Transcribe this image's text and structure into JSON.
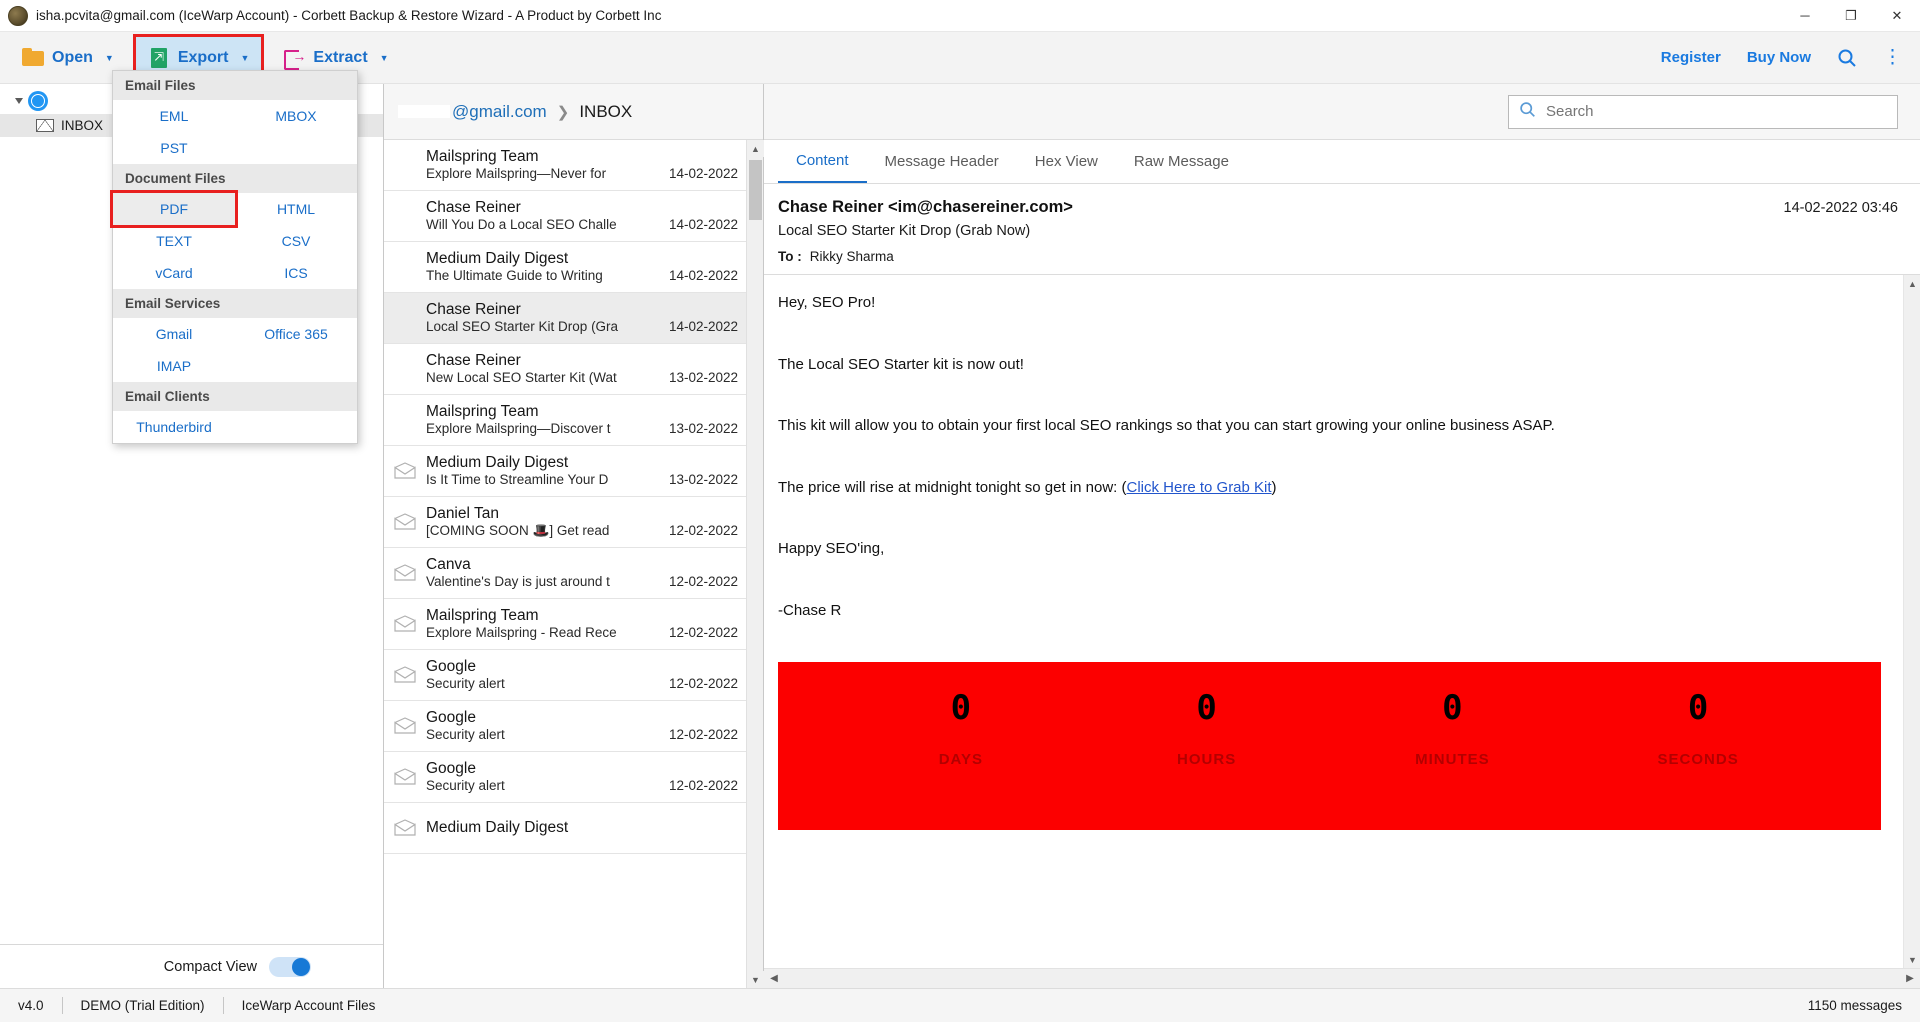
{
  "titlebar": {
    "title": "isha.pcvita@gmail.com (IceWarp Account) - Corbett Backup & Restore Wizard - A Product by Corbett Inc",
    "minimize": "─",
    "maximize": "❐",
    "close": "✕"
  },
  "toolbar": {
    "open_label": "Open",
    "export_label": "Export",
    "extract_label": "Extract",
    "caret": "▼",
    "register_label": "Register",
    "buy_now_label": "Buy Now",
    "search_icon": "⚲",
    "more_icon": "⋮"
  },
  "export_menu": {
    "sections": [
      {
        "heading": "Email Files",
        "items": [
          "EML",
          "MBOX",
          "PST"
        ]
      },
      {
        "heading": "Document Files",
        "items": [
          "PDF",
          "HTML",
          "TEXT",
          "CSV",
          "vCard",
          "ICS"
        ]
      },
      {
        "heading": "Email Services",
        "items": [
          "Gmail",
          "Office 365",
          "IMAP"
        ]
      },
      {
        "heading": "Email Clients",
        "items": [
          "Thunderbird"
        ]
      }
    ],
    "highlighted": "PDF"
  },
  "sidebar": {
    "root_label": "",
    "child_label": "INBOX",
    "compact_view_label": "Compact View",
    "compact_view_on": true
  },
  "breadcrumb": {
    "account": "@gmail.com",
    "separator": "❯",
    "folder": "INBOX"
  },
  "search": {
    "placeholder": "Search",
    "value": ""
  },
  "mail_list": [
    {
      "from": "Mailspring Team",
      "subject": "Explore Mailspring—Never for",
      "date": "14-02-2022",
      "unread": false,
      "selected": false
    },
    {
      "from": "Chase Reiner",
      "subject": "Will You Do a Local SEO Challe",
      "date": "14-02-2022",
      "unread": false,
      "selected": false
    },
    {
      "from": "Medium Daily Digest",
      "subject": "The Ultimate Guide to Writing",
      "date": "14-02-2022",
      "unread": false,
      "selected": false
    },
    {
      "from": "Chase Reiner",
      "subject": "Local SEO Starter Kit Drop (Gra",
      "date": "14-02-2022",
      "unread": false,
      "selected": true
    },
    {
      "from": "Chase Reiner",
      "subject": "New Local SEO Starter Kit (Wat",
      "date": "13-02-2022",
      "unread": false,
      "selected": false
    },
    {
      "from": "Mailspring Team",
      "subject": "Explore Mailspring—Discover t",
      "date": "13-02-2022",
      "unread": false,
      "selected": false
    },
    {
      "from": "Medium Daily Digest",
      "subject": "Is It Time to Streamline Your D",
      "date": "13-02-2022",
      "unread": true,
      "selected": false
    },
    {
      "from": "Daniel Tan",
      "subject": "[COMING SOON 🎩] Get read",
      "date": "12-02-2022",
      "unread": true,
      "selected": false
    },
    {
      "from": "Canva",
      "subject": "Valentine's Day is just around t",
      "date": "12-02-2022",
      "unread": true,
      "selected": false
    },
    {
      "from": "Mailspring Team",
      "subject": "Explore Mailspring - Read Rece",
      "date": "12-02-2022",
      "unread": true,
      "selected": false
    },
    {
      "from": "Google",
      "subject": "Security alert",
      "date": "12-02-2022",
      "unread": true,
      "selected": false
    },
    {
      "from": "Google",
      "subject": "Security alert",
      "date": "12-02-2022",
      "unread": true,
      "selected": false
    },
    {
      "from": "Google",
      "subject": "Security alert",
      "date": "12-02-2022",
      "unread": true,
      "selected": false
    },
    {
      "from": "Medium Daily Digest",
      "subject": "",
      "date": "",
      "unread": true,
      "selected": false
    }
  ],
  "tabs": [
    {
      "label": "Content",
      "active": true
    },
    {
      "label": "Message Header",
      "active": false
    },
    {
      "label": "Hex View",
      "active": false
    },
    {
      "label": "Raw Message",
      "active": false
    }
  ],
  "message": {
    "sender": "Chase Reiner <im@chasereiner.com>",
    "datetime": "14-02-2022 03:46",
    "subject": "Local SEO Starter Kit Drop (Grab Now)",
    "to_label": "To :",
    "to_value": "Rikky Sharma",
    "body": [
      "Hey, SEO Pro!",
      "The Local SEO Starter kit is now out!",
      "This kit will allow you to obtain your first local SEO rankings so that you can start growing your online business ASAP."
    ],
    "price_line_prefix": "The price will rise at midnight tonight so get in now: (",
    "price_link": "Click Here to Grab Kit",
    "price_line_suffix": ")",
    "sign_off": "Happy SEO'ing,",
    "signature": "-Chase R",
    "countdown": {
      "banner_color": "#fc0000",
      "cells": [
        {
          "value": "0",
          "label": "DAYS"
        },
        {
          "value": "0",
          "label": "HOURS"
        },
        {
          "value": "0",
          "label": "MINUTES"
        },
        {
          "value": "0",
          "label": "SECONDS"
        }
      ]
    }
  },
  "statusbar": {
    "version": "v4.0",
    "edition": "DEMO (Trial Edition)",
    "account": "IceWarp Account Files",
    "message_count": "1150  messages"
  },
  "colors": {
    "accent_blue": "#1a6ec8",
    "highlight_red": "#e8201f",
    "banner_red": "#fc0000"
  }
}
